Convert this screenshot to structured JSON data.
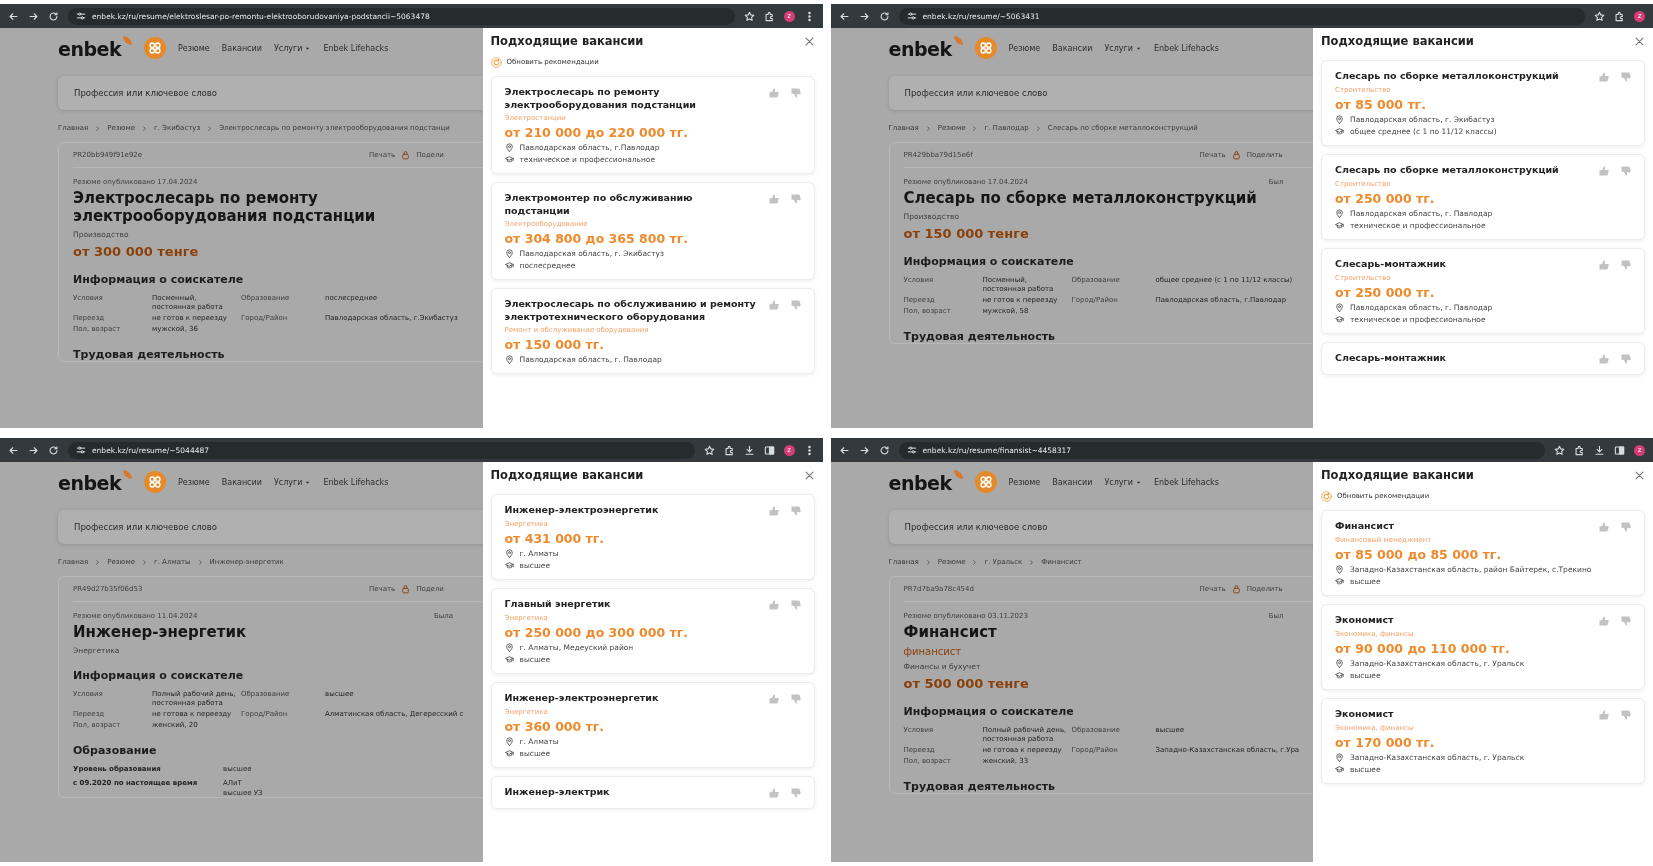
{
  "screens": [
    {
      "browser": {
        "url": "enbek.kz/ru/resume/elektroslesar-po-remontu-elektrooborudovaniya-podstancii~5063478",
        "toolbar": [
          {
            "kind": "star"
          },
          {
            "kind": "extensions"
          },
          {
            "kind": "avatar",
            "text": "z"
          },
          {
            "kind": "menu"
          }
        ]
      },
      "site": {
        "logo": "enbek",
        "nav": [
          {
            "label": "Резюме",
            "dropdown": false
          },
          {
            "label": "Вакансии",
            "dropdown": false
          },
          {
            "label": "Услуги",
            "dropdown": true
          },
          {
            "label": "Enbek Lifehacks",
            "dropdown": false
          }
        ],
        "search_placeholder": "Профессия или ключевое слово",
        "breadcrumbs": [
          "Главная",
          "Резюме",
          "г. Экибастуз",
          "Электрослесарь по ремонту электрооборудования подстанци"
        ],
        "resume": {
          "id": "PR20bb949f91e92e",
          "print": "Печать",
          "share": "Подели",
          "published": "Резюме опубликовано 17.04.2024",
          "title": "Электрослесарь по ремонту электрооборудования подстанции",
          "category": "Производство",
          "salary": "от 300 000 тенге",
          "info_heading": "Информация о соискателе",
          "info_left": [
            {
              "label": "Условия",
              "value": "Посменный, постоянная работа"
            },
            {
              "label": "Переезд",
              "value": "не готов к переезду"
            },
            {
              "label": "Пол, возраст",
              "value": "мужской, 36"
            }
          ],
          "info_right": [
            {
              "label": "Образование",
              "value": "послесреднее"
            },
            {
              "label": "Город/Район",
              "value": "Павлодарская область, г.Экибастуз"
            }
          ],
          "next_section": {
            "heading": "Трудовая деятельность"
          }
        }
      },
      "panel": {
        "title": "Подходящие вакансии",
        "refresh": "Обновить рекомендации",
        "vacancies": [
          {
            "title": "Электрослесарь по ремонту электрооборудования подстанции",
            "category": "Электростанции",
            "salary": "от 210 000 до 220 000 тг.",
            "location": "Павлодарская область, г.Павлодар",
            "education": "техническое и профессиональное"
          },
          {
            "title": "Электромонтер по обслуживанию подстанции",
            "category": "Электрооборудование",
            "salary": "от 304 800 до 365 800 тг.",
            "location": "Павлодарская область, г. Экибастуз",
            "education": "послесреднее"
          },
          {
            "title": "Электрослесарь по обслуживанию и ремонту электротехнического оборудования",
            "category": "Ремонт и обслуживание оборудования",
            "salary": "от 150 000 тг.",
            "location": "Павлодарская область, г. Павлодар"
          }
        ]
      }
    },
    {
      "browser": {
        "url": "enbek.kz/ru/resume/~5063431",
        "toolbar": [
          {
            "kind": "star"
          },
          {
            "kind": "extensions"
          },
          {
            "kind": "avatar",
            "text": "z"
          }
        ]
      },
      "site": {
        "logo": "enbek",
        "nav": [
          {
            "label": "Резюме",
            "dropdown": false
          },
          {
            "label": "Вакансии",
            "dropdown": false
          },
          {
            "label": "Услуги",
            "dropdown": true
          },
          {
            "label": "Enbek Lifehacks",
            "dropdown": false
          }
        ],
        "search_placeholder": "Профессия или ключевое слово",
        "breadcrumbs": [
          "Главная",
          "Резюме",
          "г. Павлодар",
          "Слесарь по сборке металлоконструкций"
        ],
        "resume": {
          "id": "PR429bba79d15e6f",
          "print": "Печать",
          "share": "Поделить",
          "published": "Резюме опубликовано 17.04.2024",
          "last_seen": "Был",
          "title": "Слесарь по сборке металлоконструкций",
          "category": "Производство",
          "salary": "от 150 000 тенге",
          "info_heading": "Информация о соискателе",
          "info_left": [
            {
              "label": "Условия",
              "value": "Посменный, постоянная работа"
            },
            {
              "label": "Переезд",
              "value": "не готов к переезду"
            },
            {
              "label": "Пол, возраст",
              "value": "мужской, 58"
            }
          ],
          "info_right": [
            {
              "label": "Образование",
              "value": "общее среднее (с 1 по 11/12 классы)"
            },
            {
              "label": "Город/Район",
              "value": "Павлодарская область, г.Павлодар"
            }
          ],
          "next_section": {
            "heading": "Трудовая деятельность"
          }
        }
      },
      "panel": {
        "title": "Подходящие вакансии",
        "vacancies": [
          {
            "title": "Слесарь по сборке металлоконструкций",
            "category": "Строительство",
            "salary": "от 85 000 тг.",
            "location": "Павлодарская область, г. Экибастуз",
            "education": "общее среднее (с 1 по 11/12 классы)"
          },
          {
            "title": "Слесарь по сборке металлоконструкций",
            "category": "Строительство",
            "salary": "от 250 000 тг.",
            "location": "Павлодарская область, г. Павлодар",
            "education": "техническое и профессиональное"
          },
          {
            "title": "Слесарь-монтажник",
            "category": "Строительство",
            "salary": "от 250 000 тг.",
            "location": "Павлодарская область, г. Павлодар",
            "education": "техническое и профессиональное"
          },
          {
            "title": "Слесарь-монтажник"
          }
        ]
      }
    },
    {
      "browser": {
        "url": "enbek.kz/ru/resume/~5044487",
        "toolbar": [
          {
            "kind": "star"
          },
          {
            "kind": "extensions"
          },
          {
            "kind": "download"
          },
          {
            "kind": "sidepanel"
          },
          {
            "kind": "avatar",
            "text": "z"
          },
          {
            "kind": "menu"
          }
        ]
      },
      "site": {
        "logo": "enbek",
        "nav": [
          {
            "label": "Резюме",
            "dropdown": false
          },
          {
            "label": "Вакансии",
            "dropdown": false
          },
          {
            "label": "Услуги",
            "dropdown": true
          },
          {
            "label": "Enbek Lifehacks",
            "dropdown": false
          }
        ],
        "search_placeholder": "Профессия или ключевое слово",
        "breadcrumbs": [
          "Главная",
          "Резюме",
          "г. Алматы",
          "Инженер-энергетик"
        ],
        "resume": {
          "id": "PR49d27b35f06d53",
          "print": "Печать",
          "share": "Подели",
          "published": "Резюме опубликовано 11.04.2024",
          "last_seen": "Была",
          "title": "Инженер-энергетик",
          "category": "Энергетика",
          "info_heading": "Информация о соискателе",
          "info_left": [
            {
              "label": "Условия",
              "value": "Полный рабочий день, постоянная работа"
            },
            {
              "label": "Переезд",
              "value": "не готова к переезду"
            },
            {
              "label": "Пол, возраст",
              "value": "женский, 20"
            }
          ],
          "info_right": [
            {
              "label": "Образование",
              "value": "высшее"
            },
            {
              "label": "Город/Район",
              "value": "Алматинская область, Дегересский с"
            }
          ],
          "next_section": {
            "heading": "Образование",
            "rows": [
              {
                "label": "Уровень образования",
                "values": [
                  "высшее"
                ]
              },
              {
                "label": "с 09.2020 по настоящее время",
                "values": [
                  "АЛиТ",
                  "высшее УЗ"
                ]
              }
            ]
          }
        }
      },
      "panel": {
        "title": "Подходящие вакансии",
        "vacancies": [
          {
            "title": "Инженер-электроэнергетик",
            "category": "Энергетика",
            "salary": "от 431 000 тг.",
            "location": "г. Алматы",
            "education": "высшее"
          },
          {
            "title": "Главный энергетик",
            "category": "Энергетика",
            "salary": "от 250 000 до 300 000 тг.",
            "location": "г. Алматы, Медеуский район",
            "education": "высшее"
          },
          {
            "title": "Инженер-электроэнергетик",
            "category": "Энергетика",
            "salary": "от 360 000 тг.",
            "location": "г. Алматы",
            "education": "высшее"
          },
          {
            "title": "Инженер-электрик"
          }
        ]
      }
    },
    {
      "browser": {
        "url": "enbek.kz/ru/resume/finansist~4458317",
        "toolbar": [
          {
            "kind": "star"
          },
          {
            "kind": "extensions"
          },
          {
            "kind": "download"
          },
          {
            "kind": "sidepanel"
          },
          {
            "kind": "avatar",
            "text": "z"
          }
        ]
      },
      "site": {
        "logo": "enbek",
        "nav": [
          {
            "label": "Резюме",
            "dropdown": false
          },
          {
            "label": "Вакансии",
            "dropdown": false
          },
          {
            "label": "Услуги",
            "dropdown": true
          },
          {
            "label": "Enbek Lifehacks",
            "dropdown": false
          }
        ],
        "search_placeholder": "Профессия или ключевое слово",
        "breadcrumbs": [
          "Главная",
          "Резюме",
          "г. Уральск",
          "Финансист"
        ],
        "resume": {
          "id": "PR7d7ba9a78c454d",
          "print": "Печать",
          "share": "Поделить",
          "published": "Резюме опубликовано 03.11.2023",
          "last_seen": "Был",
          "title": "Финансист",
          "subtitle": "финансист",
          "category": "Финансы и бухучет",
          "salary": "от 500 000 тенге",
          "info_heading": "Информация о соискателе",
          "info_left": [
            {
              "label": "Условия",
              "value": "Полный рабочий день, постоянная работа"
            },
            {
              "label": "Переезд",
              "value": "не готова к переезду"
            },
            {
              "label": "Пол, возраст",
              "value": "женский, 33"
            }
          ],
          "info_right": [
            {
              "label": "Образование",
              "value": "высшее"
            },
            {
              "label": "Город/Район",
              "value": "Западно-Казахстанская область, г.Ура"
            }
          ],
          "next_section": {
            "heading": "Трудовая деятельность"
          }
        }
      },
      "panel": {
        "title": "Подходящие вакансии",
        "refresh": "Обновить рекомендации",
        "vacancies": [
          {
            "title": "Финансист",
            "category": "Финансовый менеджмент",
            "salary": "от 85 000 до 85 000 тг.",
            "location": "Западно-Казахстанская область, район Байтерек, с.Трекино",
            "education": "высшее"
          },
          {
            "title": "Экономист",
            "category": "Экономика, финансы",
            "salary": "от 90 000 до 110 000 тг.",
            "location": "Западно-Казахстанская область, г. Уральск",
            "education": "высшее"
          },
          {
            "title": "Экономист",
            "category": "Экономика, финансы",
            "salary": "от 170 000 тг.",
            "location": "Западно-Казахстанская область, г. Уральск",
            "education": "высшее"
          }
        ]
      }
    }
  ]
}
